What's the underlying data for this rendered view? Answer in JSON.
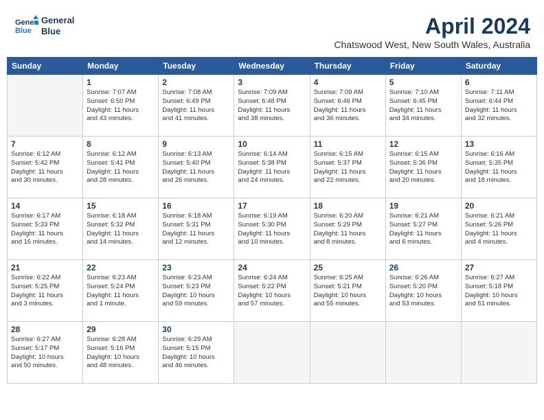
{
  "header": {
    "logo_line1": "General",
    "logo_line2": "Blue",
    "month_title": "April 2024",
    "location": "Chatswood West, New South Wales, Australia"
  },
  "days_of_week": [
    "Sunday",
    "Monday",
    "Tuesday",
    "Wednesday",
    "Thursday",
    "Friday",
    "Saturday"
  ],
  "weeks": [
    [
      {
        "day": "",
        "info": ""
      },
      {
        "day": "1",
        "info": "Sunrise: 7:07 AM\nSunset: 6:50 PM\nDaylight: 11 hours\nand 43 minutes."
      },
      {
        "day": "2",
        "info": "Sunrise: 7:08 AM\nSunset: 6:49 PM\nDaylight: 11 hours\nand 41 minutes."
      },
      {
        "day": "3",
        "info": "Sunrise: 7:09 AM\nSunset: 6:48 PM\nDaylight: 11 hours\nand 38 minutes."
      },
      {
        "day": "4",
        "info": "Sunrise: 7:09 AM\nSunset: 6:46 PM\nDaylight: 11 hours\nand 36 minutes."
      },
      {
        "day": "5",
        "info": "Sunrise: 7:10 AM\nSunset: 6:45 PM\nDaylight: 11 hours\nand 34 minutes."
      },
      {
        "day": "6",
        "info": "Sunrise: 7:11 AM\nSunset: 6:44 PM\nDaylight: 11 hours\nand 32 minutes."
      }
    ],
    [
      {
        "day": "7",
        "info": "Sunrise: 6:12 AM\nSunset: 5:42 PM\nDaylight: 11 hours\nand 30 minutes."
      },
      {
        "day": "8",
        "info": "Sunrise: 6:12 AM\nSunset: 5:41 PM\nDaylight: 11 hours\nand 28 minutes."
      },
      {
        "day": "9",
        "info": "Sunrise: 6:13 AM\nSunset: 5:40 PM\nDaylight: 11 hours\nand 26 minutes."
      },
      {
        "day": "10",
        "info": "Sunrise: 6:14 AM\nSunset: 5:38 PM\nDaylight: 11 hours\nand 24 minutes."
      },
      {
        "day": "11",
        "info": "Sunrise: 6:15 AM\nSunset: 5:37 PM\nDaylight: 11 hours\nand 22 minutes."
      },
      {
        "day": "12",
        "info": "Sunrise: 6:15 AM\nSunset: 5:36 PM\nDaylight: 11 hours\nand 20 minutes."
      },
      {
        "day": "13",
        "info": "Sunrise: 6:16 AM\nSunset: 5:35 PM\nDaylight: 11 hours\nand 18 minutes."
      }
    ],
    [
      {
        "day": "14",
        "info": "Sunrise: 6:17 AM\nSunset: 5:33 PM\nDaylight: 11 hours\nand 16 minutes."
      },
      {
        "day": "15",
        "info": "Sunrise: 6:18 AM\nSunset: 5:32 PM\nDaylight: 11 hours\nand 14 minutes."
      },
      {
        "day": "16",
        "info": "Sunrise: 6:18 AM\nSunset: 5:31 PM\nDaylight: 11 hours\nand 12 minutes."
      },
      {
        "day": "17",
        "info": "Sunrise: 6:19 AM\nSunset: 5:30 PM\nDaylight: 11 hours\nand 10 minutes."
      },
      {
        "day": "18",
        "info": "Sunrise: 6:20 AM\nSunset: 5:29 PM\nDaylight: 11 hours\nand 8 minutes."
      },
      {
        "day": "19",
        "info": "Sunrise: 6:21 AM\nSunset: 5:27 PM\nDaylight: 11 hours\nand 6 minutes."
      },
      {
        "day": "20",
        "info": "Sunrise: 6:21 AM\nSunset: 5:26 PM\nDaylight: 11 hours\nand 4 minutes."
      }
    ],
    [
      {
        "day": "21",
        "info": "Sunrise: 6:22 AM\nSunset: 5:25 PM\nDaylight: 11 hours\nand 3 minutes."
      },
      {
        "day": "22",
        "info": "Sunrise: 6:23 AM\nSunset: 5:24 PM\nDaylight: 11 hours\nand 1 minute."
      },
      {
        "day": "23",
        "info": "Sunrise: 6:23 AM\nSunset: 5:23 PM\nDaylight: 10 hours\nand 59 minutes."
      },
      {
        "day": "24",
        "info": "Sunrise: 6:24 AM\nSunset: 5:22 PM\nDaylight: 10 hours\nand 57 minutes."
      },
      {
        "day": "25",
        "info": "Sunrise: 6:25 AM\nSunset: 5:21 PM\nDaylight: 10 hours\nand 55 minutes."
      },
      {
        "day": "26",
        "info": "Sunrise: 6:26 AM\nSunset: 5:20 PM\nDaylight: 10 hours\nand 53 minutes."
      },
      {
        "day": "27",
        "info": "Sunrise: 6:27 AM\nSunset: 5:18 PM\nDaylight: 10 hours\nand 51 minutes."
      }
    ],
    [
      {
        "day": "28",
        "info": "Sunrise: 6:27 AM\nSunset: 5:17 PM\nDaylight: 10 hours\nand 50 minutes."
      },
      {
        "day": "29",
        "info": "Sunrise: 6:28 AM\nSunset: 5:16 PM\nDaylight: 10 hours\nand 48 minutes."
      },
      {
        "day": "30",
        "info": "Sunrise: 6:29 AM\nSunset: 5:15 PM\nDaylight: 10 hours\nand 46 minutes."
      },
      {
        "day": "",
        "info": ""
      },
      {
        "day": "",
        "info": ""
      },
      {
        "day": "",
        "info": ""
      },
      {
        "day": "",
        "info": ""
      }
    ]
  ]
}
